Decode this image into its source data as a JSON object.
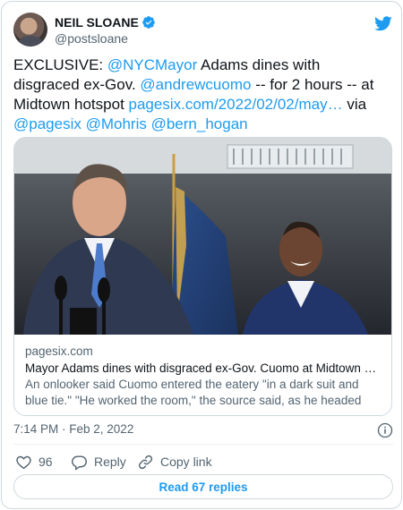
{
  "author": {
    "name": "NEIL SLOANE",
    "handle": "@postsloane"
  },
  "tweet": {
    "parts": [
      {
        "text": "EXCLUSIVE: ",
        "link": false
      },
      {
        "text": "@NYCMayor",
        "link": true
      },
      {
        "text": " Adams dines with disgraced ex-Gov. ",
        "link": false
      },
      {
        "text": "@andrewcuomo",
        "link": true
      },
      {
        "text": " -- for 2 hours -- at Midtown hotspot ",
        "link": false
      },
      {
        "text": "pagesix.com/2022/02/02/may…",
        "link": true
      },
      {
        "text": " via ",
        "link": false
      },
      {
        "text": "@pagesix",
        "link": true
      },
      {
        "text": " ",
        "link": false
      },
      {
        "text": "@Mohris",
        "link": true
      },
      {
        "text": " ",
        "link": false
      },
      {
        "text": "@bern_hogan",
        "link": true
      }
    ]
  },
  "link_card": {
    "domain": "pagesix.com",
    "title": "Mayor Adams dines with disgraced ex-Gov. Cuomo at Midtown hot...",
    "description": "An onlooker said Cuomo entered the eatery \"in a dark suit and blue tie.\" \"He worked the room,\" the source said, as he headed into a ..."
  },
  "timestamp": "7:14 PM · Feb 2, 2022",
  "actions": {
    "like_count": "96",
    "reply_label": "Reply",
    "copy_label": "Copy link"
  },
  "read_replies_label": "Read 67 replies",
  "colors": {
    "accent": "#1d9bf0",
    "text": "#0f1419",
    "muted": "#536471",
    "border": "#cfd9de"
  },
  "icons": [
    "verified-badge-icon",
    "twitter-bird-icon",
    "info-icon",
    "heart-icon",
    "reply-bubble-icon",
    "link-icon"
  ]
}
